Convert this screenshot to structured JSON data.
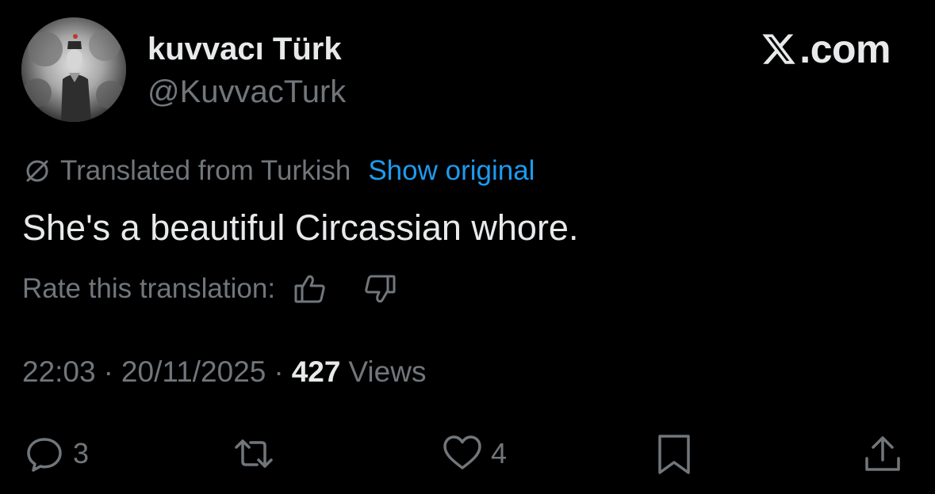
{
  "author": {
    "display_name": "kuvvacı Türk",
    "handle": "@KuvvacTurk",
    "avatar_icon": "avatar-photo"
  },
  "brand": {
    "icon": "x-logo-icon",
    "text": ".com"
  },
  "translation": {
    "icon": "globe-slash-icon",
    "label": "Translated from Turkish",
    "show_original": "Show original",
    "link_color": "#1d9bf0"
  },
  "tweet": {
    "text": "She's a beautiful Circassian whore."
  },
  "rating": {
    "label": "Rate this translation:",
    "up_icon": "thumbs-up-icon",
    "down_icon": "thumbs-down-icon"
  },
  "meta": {
    "time": "22:03",
    "separator": "·",
    "date": "20/11/2025",
    "views_count": "427",
    "views_label": "Views"
  },
  "actions": {
    "reply": {
      "icon": "reply-icon",
      "count": "3"
    },
    "repost": {
      "icon": "repost-icon",
      "count": ""
    },
    "like": {
      "icon": "heart-icon",
      "count": "4"
    },
    "bookmark": {
      "icon": "bookmark-icon"
    },
    "share": {
      "icon": "share-icon"
    }
  },
  "colors": {
    "background": "#000000",
    "primary_text": "#e7e9ea",
    "secondary_text": "#71767b",
    "accent": "#1d9bf0"
  }
}
